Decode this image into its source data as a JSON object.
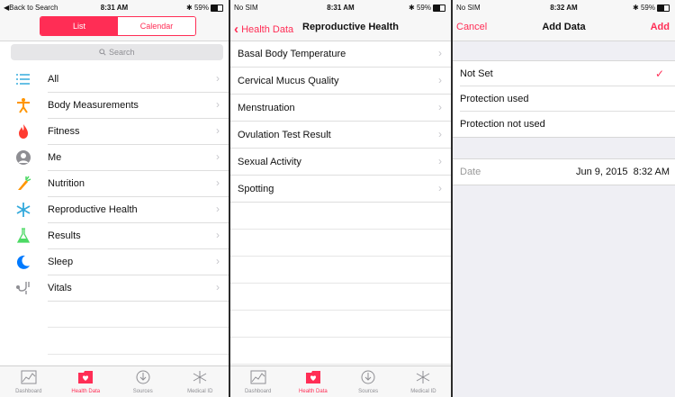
{
  "screen1": {
    "status": {
      "left": "Back to Search",
      "time": "8:31 AM",
      "battery": "59%"
    },
    "segments": {
      "list": "List",
      "calendar": "Calendar"
    },
    "search_placeholder": "Search",
    "categories": [
      {
        "label": "All",
        "icon": "list-icon",
        "color": "#34aadc"
      },
      {
        "label": "Body Measurements",
        "icon": "person-icon",
        "color": "#ff9500"
      },
      {
        "label": "Fitness",
        "icon": "flame-icon",
        "color": "#ff3b30"
      },
      {
        "label": "Me",
        "icon": "person-silhouette-icon",
        "color": "#8e8e93"
      },
      {
        "label": "Nutrition",
        "icon": "carrot-icon",
        "color": "#ff9500"
      },
      {
        "label": "Reproductive Health",
        "icon": "snowflake-icon",
        "color": "#34aadc"
      },
      {
        "label": "Results",
        "icon": "flask-icon",
        "color": "#4cd964"
      },
      {
        "label": "Sleep",
        "icon": "moon-icon",
        "color": "#007aff"
      },
      {
        "label": "Vitals",
        "icon": "stethoscope-icon",
        "color": "#8e8e93"
      }
    ],
    "tabs": [
      {
        "label": "Dashboard",
        "icon": "dashboard-icon"
      },
      {
        "label": "Health Data",
        "icon": "health-data-icon"
      },
      {
        "label": "Sources",
        "icon": "sources-icon"
      },
      {
        "label": "Medical ID",
        "icon": "medical-id-icon"
      }
    ]
  },
  "screen2": {
    "status": {
      "left": "No SIM",
      "time": "8:31 AM",
      "battery": "59%"
    },
    "back_label": "Health Data",
    "title": "Reproductive Health",
    "items": [
      "Basal Body Temperature",
      "Cervical Mucus Quality",
      "Menstruation",
      "Ovulation Test Result",
      "Sexual Activity",
      "Spotting"
    ],
    "tabs": [
      {
        "label": "Dashboard",
        "icon": "dashboard-icon"
      },
      {
        "label": "Health Data",
        "icon": "health-data-icon"
      },
      {
        "label": "Sources",
        "icon": "sources-icon"
      },
      {
        "label": "Medical ID",
        "icon": "medical-id-icon"
      }
    ]
  },
  "screen3": {
    "status": {
      "left": "No SIM",
      "time": "8:32 AM",
      "battery": "59%"
    },
    "cancel_label": "Cancel",
    "title": "Add Data",
    "add_label": "Add",
    "options": [
      {
        "label": "Not Set",
        "selected": true
      },
      {
        "label": "Protection used",
        "selected": false
      },
      {
        "label": "Protection not used",
        "selected": false
      }
    ],
    "date": {
      "label": "Date",
      "day": "Jun 9, 2015",
      "time": "8:32 AM"
    }
  },
  "colors": {
    "accent": "#ff2d55"
  }
}
